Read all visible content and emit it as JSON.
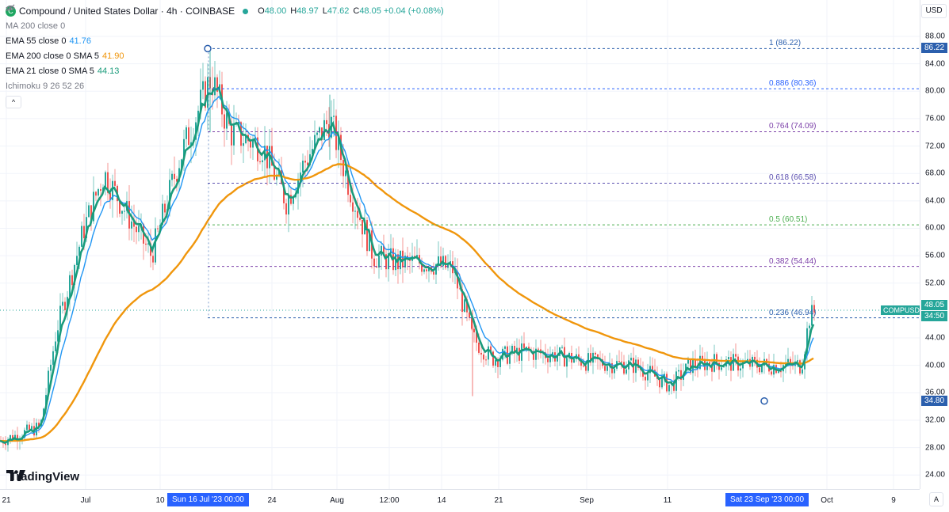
{
  "header": {
    "icon_label": "C",
    "title": "Compound / United States Dollar · 4h · COINBASE",
    "ohlc": [
      {
        "label": "O",
        "value": "48.00"
      },
      {
        "label": "H",
        "value": "48.97"
      },
      {
        "label": "L",
        "value": "47.62"
      },
      {
        "label": "C",
        "value": "48.05"
      }
    ],
    "change": "+0.04 (+0.08%)"
  },
  "indicators": [
    {
      "name": "MA 200 close 0",
      "value": "",
      "color": "#787b86",
      "hidden": true
    },
    {
      "name": "EMA 55 close 0",
      "value": "41.76",
      "color": "#2196f3",
      "hidden": false
    },
    {
      "name": "EMA 200 close 0 SMA 5",
      "value": "41.90",
      "color": "#f0960c",
      "hidden": false
    },
    {
      "name": "EMA 21 close 0 SMA 5",
      "value": "44.13",
      "color": "#1a9b7b",
      "hidden": false
    },
    {
      "name": "Ichimoku 9 26 52 26",
      "value": "",
      "color": "#787b86",
      "hidden": true
    }
  ],
  "collapse_label": "^",
  "currency": "USD",
  "auto_label": "A",
  "logo_text": "TradingView",
  "price_axis": [
    "88.00",
    "84.00",
    "80.00",
    "76.00",
    "72.00",
    "68.00",
    "64.00",
    "60.00",
    "56.00",
    "52.00",
    "44.00",
    "40.00",
    "36.00",
    "32.00",
    "28.00",
    "24.00"
  ],
  "time_axis": [
    "21",
    "Jul",
    "10",
    "24",
    "Aug",
    "12:00",
    "14",
    "21",
    "Sep",
    "11",
    "Oct",
    "9"
  ],
  "time_badges": [
    "Sun 16 Jul '23   00:00",
    "Sat 23 Sep '23   00:00"
  ],
  "price_badges": {
    "high": "86.22",
    "current": "48.05",
    "countdown": "34:50",
    "low": "34.80"
  },
  "symbol_badge": "COMPUSD",
  "fib_levels": [
    {
      "label": "1 (86.22)",
      "price": 86.22,
      "color": "#2b5fad"
    },
    {
      "label": "0.886 (80.36)",
      "price": 80.36,
      "color": "#2962ff"
    },
    {
      "label": "0.764 (74.09)",
      "price": 74.09,
      "color": "#7b3fa8"
    },
    {
      "label": "0.618 (66.58)",
      "price": 66.58,
      "color": "#5b4fb0"
    },
    {
      "label": "0.5 (60.51)",
      "price": 60.51,
      "color": "#4caf50"
    },
    {
      "label": "0.382 (54.44)",
      "price": 54.44,
      "color": "#7b3fa8"
    },
    {
      "label": "0.236 (46.94)",
      "price": 46.94,
      "color": "#2b5fad"
    }
  ],
  "colors": {
    "up": "#26a69a",
    "down": "#ef5350",
    "grid": "#f0f3fa"
  }
}
